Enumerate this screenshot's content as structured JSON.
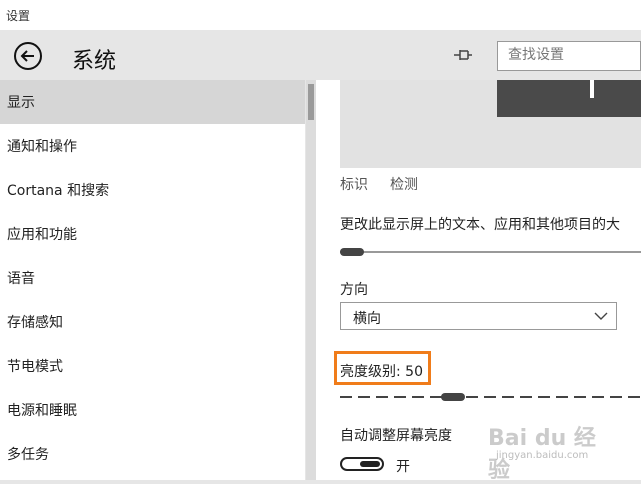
{
  "window": {
    "title": "设置"
  },
  "header": {
    "title": "系统",
    "search_placeholder": "查找设置"
  },
  "sidebar": {
    "items": [
      {
        "label": "显示",
        "selected": true
      },
      {
        "label": "通知和操作"
      },
      {
        "label": "Cortana 和搜索"
      },
      {
        "label": "应用和功能"
      },
      {
        "label": "语音"
      },
      {
        "label": "存储感知"
      },
      {
        "label": "节电模式"
      },
      {
        "label": "电源和睡眠"
      },
      {
        "label": "多任务"
      }
    ]
  },
  "display": {
    "links": {
      "identify": "标识",
      "detect": "检测"
    },
    "scale_label": "更改此显示屏上的文本、应用和其他项目的大",
    "scale_level": 0,
    "orientation_label": "方向",
    "orientation_value": "横向",
    "brightness_label": "亮度级别: 50",
    "brightness_value": 50,
    "auto_brightness_label": "自动调整屏幕亮度",
    "auto_brightness_state": "开"
  },
  "watermark": {
    "text": "Bai du 经验",
    "sub": "jingyan.baidu.com"
  },
  "colors": {
    "highlight": "#f07c1a",
    "monitor": "#4a4a4a",
    "selected": "#d6d6d6"
  }
}
